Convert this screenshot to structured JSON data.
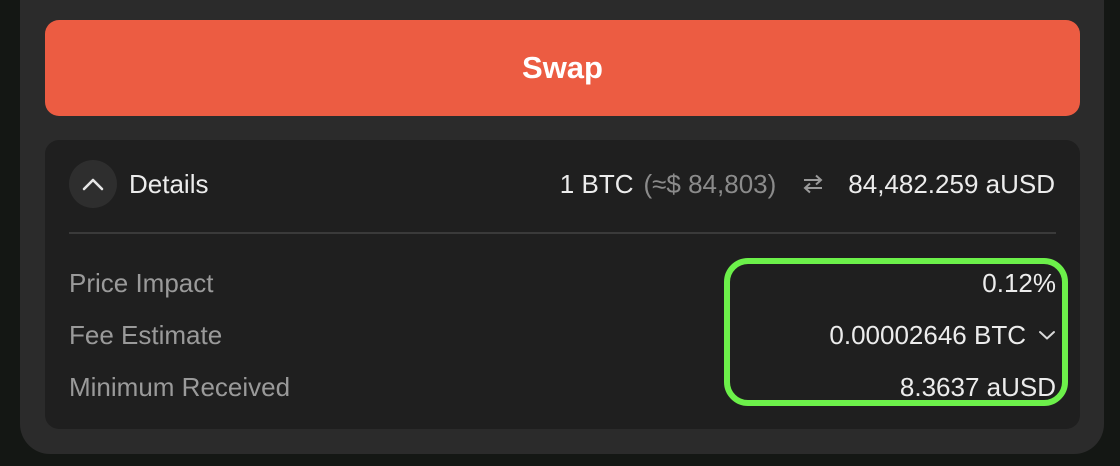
{
  "swap": {
    "button_label": "Swap"
  },
  "details": {
    "toggle_label": "Details",
    "rate": {
      "from": "1 BTC",
      "from_usd": "(≈$ 84,803)",
      "to": "84,482.259 aUSD"
    },
    "rows": [
      {
        "label": "Price Impact",
        "value": "0.12%"
      },
      {
        "label": "Fee Estimate",
        "value": "0.00002646 BTC"
      },
      {
        "label": "Minimum Received",
        "value": "8.3637 aUSD"
      }
    ]
  },
  "colors": {
    "accent": "#ec5c42",
    "highlight": "#6cf04a",
    "panel": "#2b2b2b",
    "card": "#1f1f1f"
  },
  "icons": {
    "collapse": "chevron-up-icon",
    "swap_direction": "swap-arrows-icon",
    "fee_dropdown": "chevron-down-icon"
  }
}
